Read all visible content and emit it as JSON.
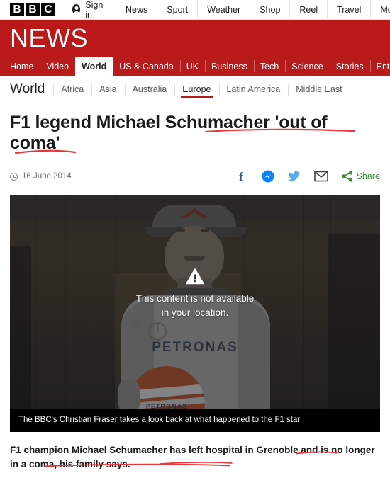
{
  "topbar": {
    "logo_letters": [
      "B",
      "B",
      "C"
    ],
    "signin_label": "Sign in",
    "nav_items": [
      "News",
      "Sport",
      "Weather",
      "Shop",
      "Reel",
      "Travel",
      "Mo"
    ]
  },
  "masthead": {
    "title": "NEWS",
    "brand_red": "#bb1919"
  },
  "mainnav": {
    "items": [
      {
        "label": "Home",
        "active": false
      },
      {
        "label": "Video",
        "active": false
      },
      {
        "label": "World",
        "active": true
      },
      {
        "label": "US & Canada",
        "active": false
      },
      {
        "label": "UK",
        "active": false
      },
      {
        "label": "Business",
        "active": false
      },
      {
        "label": "Tech",
        "active": false
      },
      {
        "label": "Science",
        "active": false
      },
      {
        "label": "Stories",
        "active": false
      },
      {
        "label": "Entert",
        "active": false
      }
    ]
  },
  "subnav": {
    "title": "World",
    "items": [
      {
        "label": "Africa",
        "active": false
      },
      {
        "label": "Asia",
        "active": false
      },
      {
        "label": "Australia",
        "active": false
      },
      {
        "label": "Europe",
        "active": true
      },
      {
        "label": "Latin America",
        "active": false
      },
      {
        "label": "Middle East",
        "active": false
      }
    ]
  },
  "article": {
    "headline": "F1 legend Michael Schumacher 'out of coma'",
    "timestamp": "16 June 2014",
    "share": {
      "label": "Share",
      "icons": [
        "facebook-icon",
        "messenger-icon",
        "twitter-icon",
        "email-icon",
        "share-icon"
      ],
      "facebook_color": "#3b5998",
      "messenger_color": "#0084ff",
      "twitter_color": "#55acee",
      "email_color": "#404040",
      "share_color": "#3c8c3c"
    },
    "video": {
      "overlay_line1": "This content is not available",
      "overlay_line2": "in your location.",
      "suit_sponsor": "PETRONAS",
      "helmet_sponsor": "PETRONAS",
      "caption": "The BBC's Christian Fraser takes a look back at what happened to the F1 star"
    },
    "intro_paragraph": "F1 champion Michael Schumacher has left hospital in Grenoble and is no longer in a coma, his family says.",
    "annotation_color": "#e8383d"
  }
}
